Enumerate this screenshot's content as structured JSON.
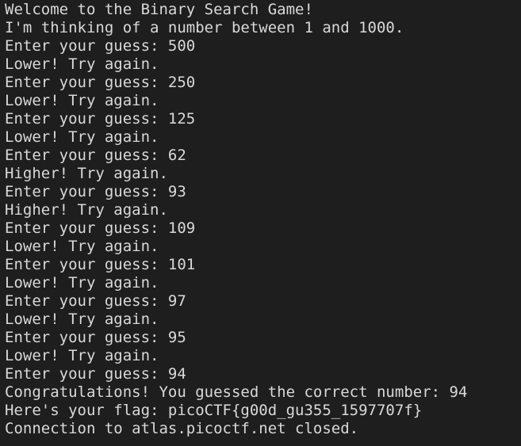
{
  "terminal": {
    "lines": [
      "Welcome to the Binary Search Game!",
      "I'm thinking of a number between 1 and 1000.",
      "Enter your guess: 500",
      "Lower! Try again.",
      "Enter your guess: 250",
      "Lower! Try again.",
      "Enter your guess: 125",
      "Lower! Try again.",
      "Enter your guess: 62",
      "Higher! Try again.",
      "Enter your guess: 93",
      "Higher! Try again.",
      "Enter your guess: 109",
      "Lower! Try again.",
      "Enter your guess: 101",
      "Lower! Try again.",
      "Enter your guess: 97",
      "Lower! Try again.",
      "Enter your guess: 95",
      "Lower! Try again.",
      "Enter your guess: 94",
      "Congratulations! You guessed the correct number: 94",
      "Here's your flag: picoCTF{g00d_gu355_1597707f}",
      "Connection to atlas.picoctf.net closed."
    ]
  }
}
